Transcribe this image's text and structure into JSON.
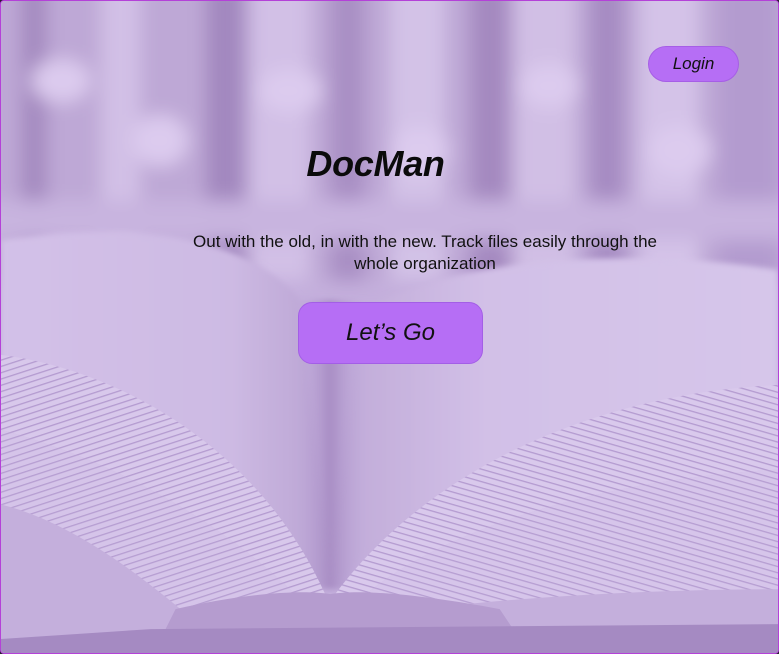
{
  "header": {
    "login_label": "Login"
  },
  "hero": {
    "title": "DocMan",
    "tagline": "Out with the old, in with the new. Track files easily through the whole organization",
    "cta_label": "Let’s Go"
  },
  "colors": {
    "accent": "#b66ef5",
    "overlay_tint": "#c9b3e2",
    "frame_border": "#b441d8",
    "text": "#111111"
  },
  "icons": {
    "background": "open-book-photo"
  }
}
